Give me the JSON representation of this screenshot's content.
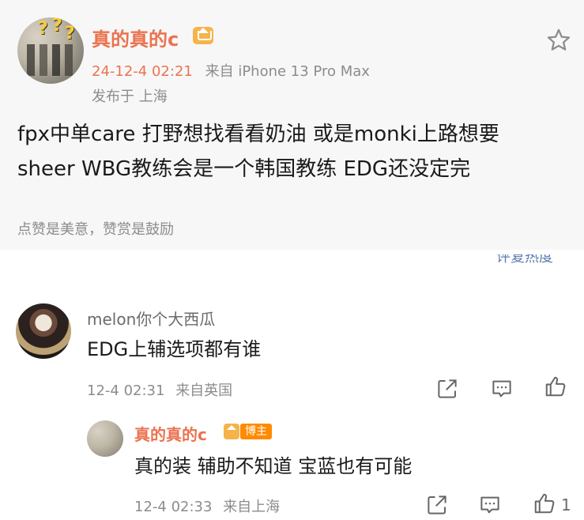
{
  "post": {
    "author": "真的真的c",
    "time": "24-12-4 02:21",
    "source": "来自 iPhone 13 Pro Max",
    "location": "发布于 上海",
    "body_line1": "fpx中单care 打野想找看看奶油 或是monki上路想要",
    "body_line2": "sheer WBG教练会是一个韩国教练 EDG还没定完",
    "reward_text": "点赞是美意，赞赏是鼓励",
    "cut_off_text": "评复热度"
  },
  "comments": [
    {
      "author": "melon你个大西瓜",
      "text": "EDG上辅选项都有谁",
      "time": "12-4 02:31",
      "source": "来自英国"
    },
    {
      "author": "真的真的c",
      "badge": "博主",
      "text": "真的装 辅助不知道 宝蓝也有可能",
      "time": "12-4 02:33",
      "source": "来自上海",
      "likes": "1"
    }
  ],
  "colors": {
    "accent_orange": "#eb7350",
    "badge_orange": "#ff8a00",
    "vip_gold": "#f6b34a",
    "muted_text": "#8c8c8c",
    "top_post_bg": "#f7f7f7"
  },
  "icons": [
    "star-icon",
    "share-icon",
    "comment-icon",
    "like-icon",
    "vip-crown-icon"
  ]
}
